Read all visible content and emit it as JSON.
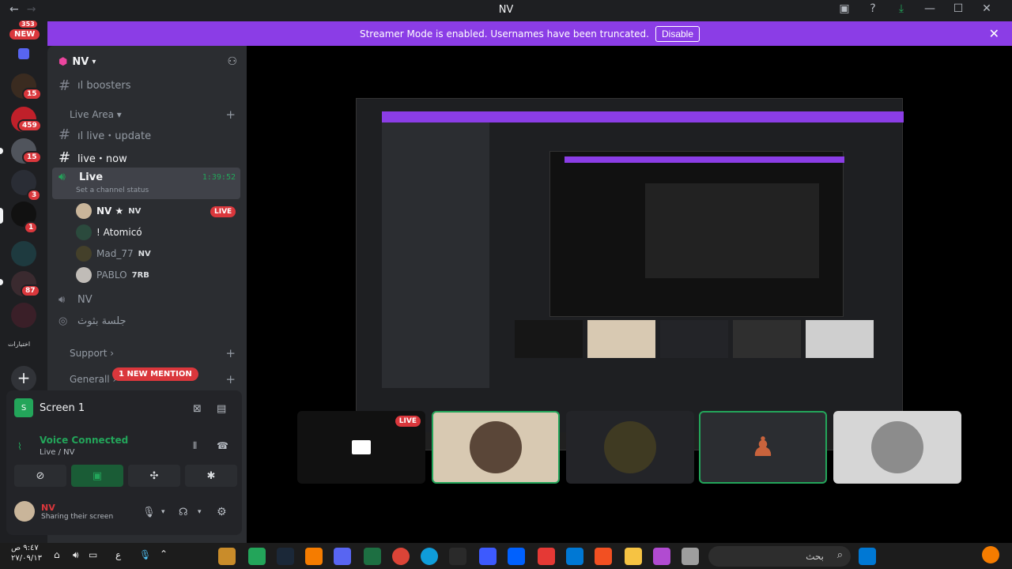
{
  "window": {
    "title": "NV"
  },
  "banner": {
    "text": "Streamer Mode is enabled. Usernames have been truncated.",
    "button": "Disable"
  },
  "rail": {
    "new_count": "353",
    "new_label": "NEW",
    "badges": [
      "15",
      "459",
      "15",
      "3",
      "1",
      "87"
    ],
    "arabic_label": "اختيارات"
  },
  "server": {
    "name": "NV"
  },
  "channels": {
    "boosters": "ıl boosters",
    "live_area_category": "Live Area",
    "live_update": "ıl live・update",
    "live_now": "live・now",
    "live_voice": "Live",
    "live_timer": "1:39:52",
    "channel_status": "Set a channel status",
    "nv_voice": "NV",
    "arabic_channel": "جلسة بثوث",
    "support_category": "Support",
    "general_category": "Generall",
    "new_mention": "1 NEW MENTION"
  },
  "voice_users": [
    {
      "name": "NV ★",
      "tag": "NV",
      "live": "LIVE"
    },
    {
      "name": "! Atomicó",
      "tag": ""
    },
    {
      "name": "Mad_77",
      "tag": "NV"
    },
    {
      "name": "PABLO",
      "tag": "7RB"
    }
  ],
  "screen_panel": {
    "title": "Screen 1",
    "voice_connected": "Voice Connected",
    "location": "Live / NV"
  },
  "user": {
    "name": "ΝV",
    "status": "Sharing their screen"
  },
  "stage": {
    "live_badge": "LIVE"
  },
  "taskbar": {
    "time": "٩:٤٧ ص",
    "date": "٢٧/٠٩/١٣",
    "lang": "ع",
    "search": "بحث"
  },
  "colors": {
    "accent": "#8b3de6",
    "green": "#23a55a",
    "red": "#da373c"
  }
}
